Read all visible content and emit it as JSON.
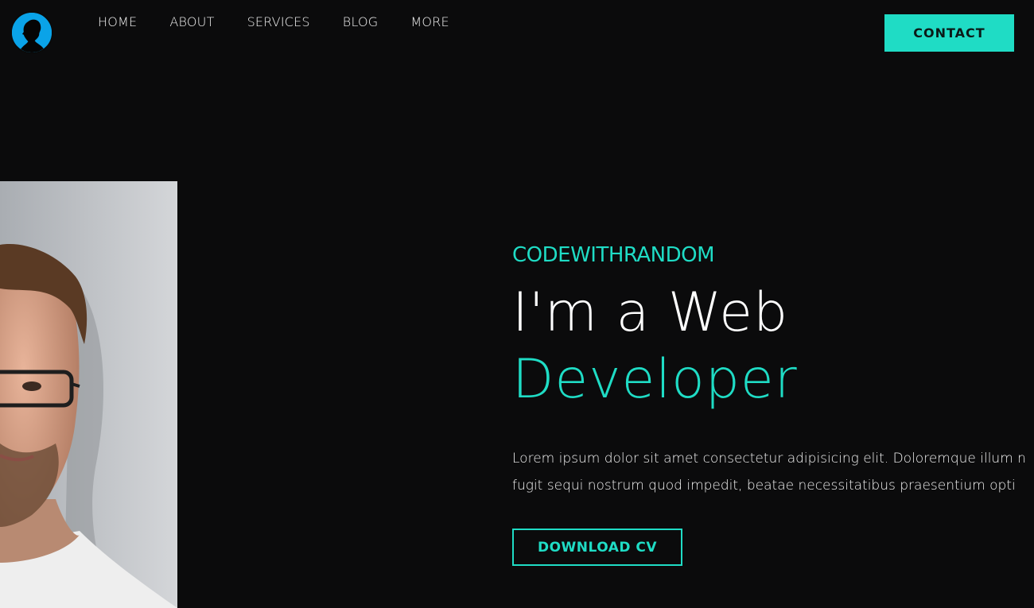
{
  "header": {
    "logo_icon": "person-silhouette-icon",
    "nav": [
      {
        "label": "HOME"
      },
      {
        "label": "ABOUT"
      },
      {
        "label": "SERVICES"
      },
      {
        "label": "BLOG"
      },
      {
        "label": "MORE"
      }
    ],
    "contact_label": "CONTACT"
  },
  "hero": {
    "brand": "CODEWITHRANDOM",
    "headline_line1": "I'm a Web",
    "headline_line2": "Developer",
    "description_line1": "Lorem ipsum dolor sit amet consectetur adipisicing elit. Doloremque illum n",
    "description_line2": "fugit sequi nostrum quod impedit, beatae necessitatibus praesentium opti",
    "cv_button": "DOWNLOAD CV"
  },
  "colors": {
    "background": "#0b0b0c",
    "accent": "#1fdcc5",
    "logo_bg": "#0aa3e8"
  }
}
